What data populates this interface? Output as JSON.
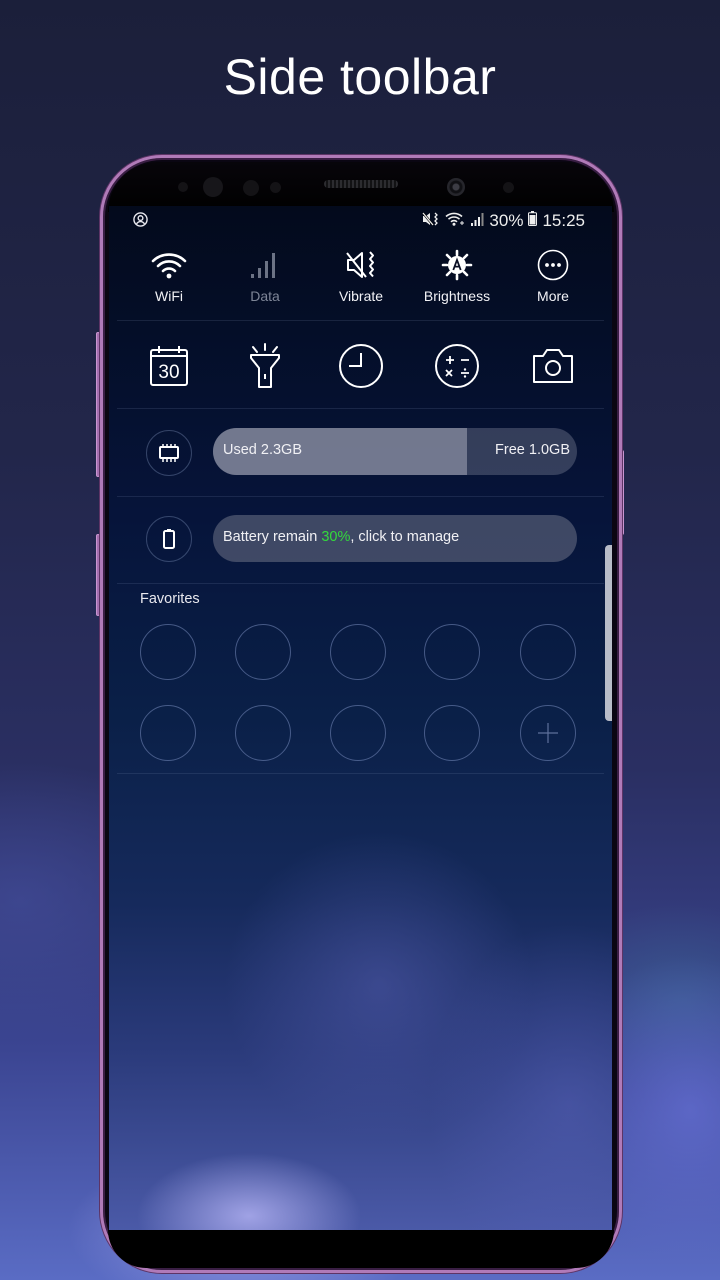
{
  "page": {
    "title": "Side toolbar"
  },
  "status_bar": {
    "battery_percent": "30%",
    "time": "15:25",
    "icons": [
      "account-icon",
      "mute-vibrate-icon",
      "wifi-icon",
      "signal-icon",
      "battery-icon"
    ]
  },
  "toggles": [
    {
      "label": "WiFi",
      "icon": "wifi-icon",
      "active": true
    },
    {
      "label": "Data",
      "icon": "mobile-data-icon",
      "active": false
    },
    {
      "label": "Vibrate",
      "icon": "vibrate-icon",
      "active": true
    },
    {
      "label": "Brightness",
      "icon": "auto-brightness-icon",
      "active": true
    },
    {
      "label": "More",
      "icon": "more-icon",
      "active": true
    }
  ],
  "shortcuts": [
    {
      "name": "calendar",
      "icon": "calendar-icon",
      "text": "30"
    },
    {
      "name": "flashlight",
      "icon": "flashlight-icon"
    },
    {
      "name": "clock",
      "icon": "clock-icon"
    },
    {
      "name": "calculator",
      "icon": "calculator-icon"
    },
    {
      "name": "camera",
      "icon": "camera-icon"
    }
  ],
  "memory": {
    "used_label": "Used 2.3GB",
    "free_label": "Free 1.0GB",
    "used_fraction": 0.697
  },
  "battery": {
    "text_before": "Battery remain ",
    "percent": "30%",
    "text_after": ", click to manage",
    "accent_color": "#33d93c"
  },
  "favorites": {
    "label": "Favorites",
    "slots": 10,
    "add_slot_index": 9
  }
}
